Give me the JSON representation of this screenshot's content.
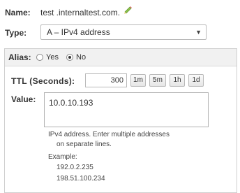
{
  "name": {
    "label": "Name:",
    "value": "test .internaltest.com."
  },
  "type": {
    "label": "Type:",
    "selected": "A – IPv4 address"
  },
  "alias": {
    "label": "Alias:",
    "options": [
      "Yes",
      "No"
    ],
    "selected": "No"
  },
  "ttl": {
    "label": "TTL (Seconds):",
    "value": "300",
    "buttons": [
      "1m",
      "5m",
      "1h",
      "1d"
    ]
  },
  "value_field": {
    "label": "Value:",
    "value": "10.0.10.193",
    "help_line1": "IPv4 address. Enter multiple addresses",
    "help_line2": "on separate lines.",
    "example_label": "Example:",
    "examples": [
      "192.0.2.235",
      "198.51.100.234"
    ]
  },
  "icons": {
    "edit": "pencil-icon"
  }
}
